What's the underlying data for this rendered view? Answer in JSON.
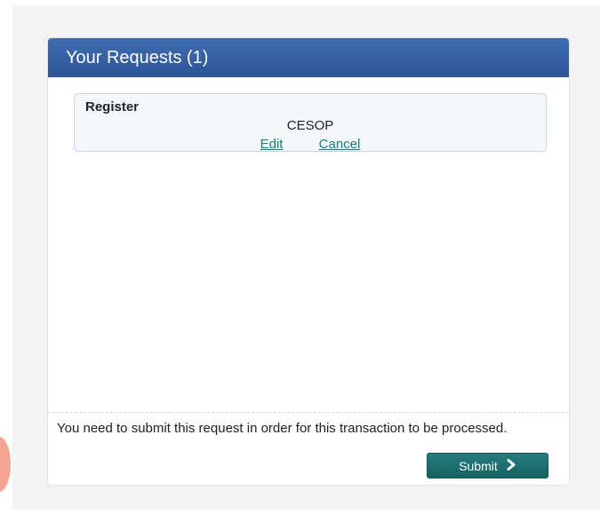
{
  "panel": {
    "title": "Your Requests (1)"
  },
  "requests": [
    {
      "type": "Register",
      "item": "CESOP",
      "edit_label": "Edit",
      "cancel_label": "Cancel"
    }
  ],
  "footer": {
    "message": "You need to submit this request in order for this transaction to be processed.",
    "submit_label": "Submit",
    "submit_icon": "chevron-right-icon"
  },
  "colors": {
    "header_bg": "#3a66ab",
    "link": "#1c7a78",
    "submit_bg": "#1d6f6f"
  }
}
